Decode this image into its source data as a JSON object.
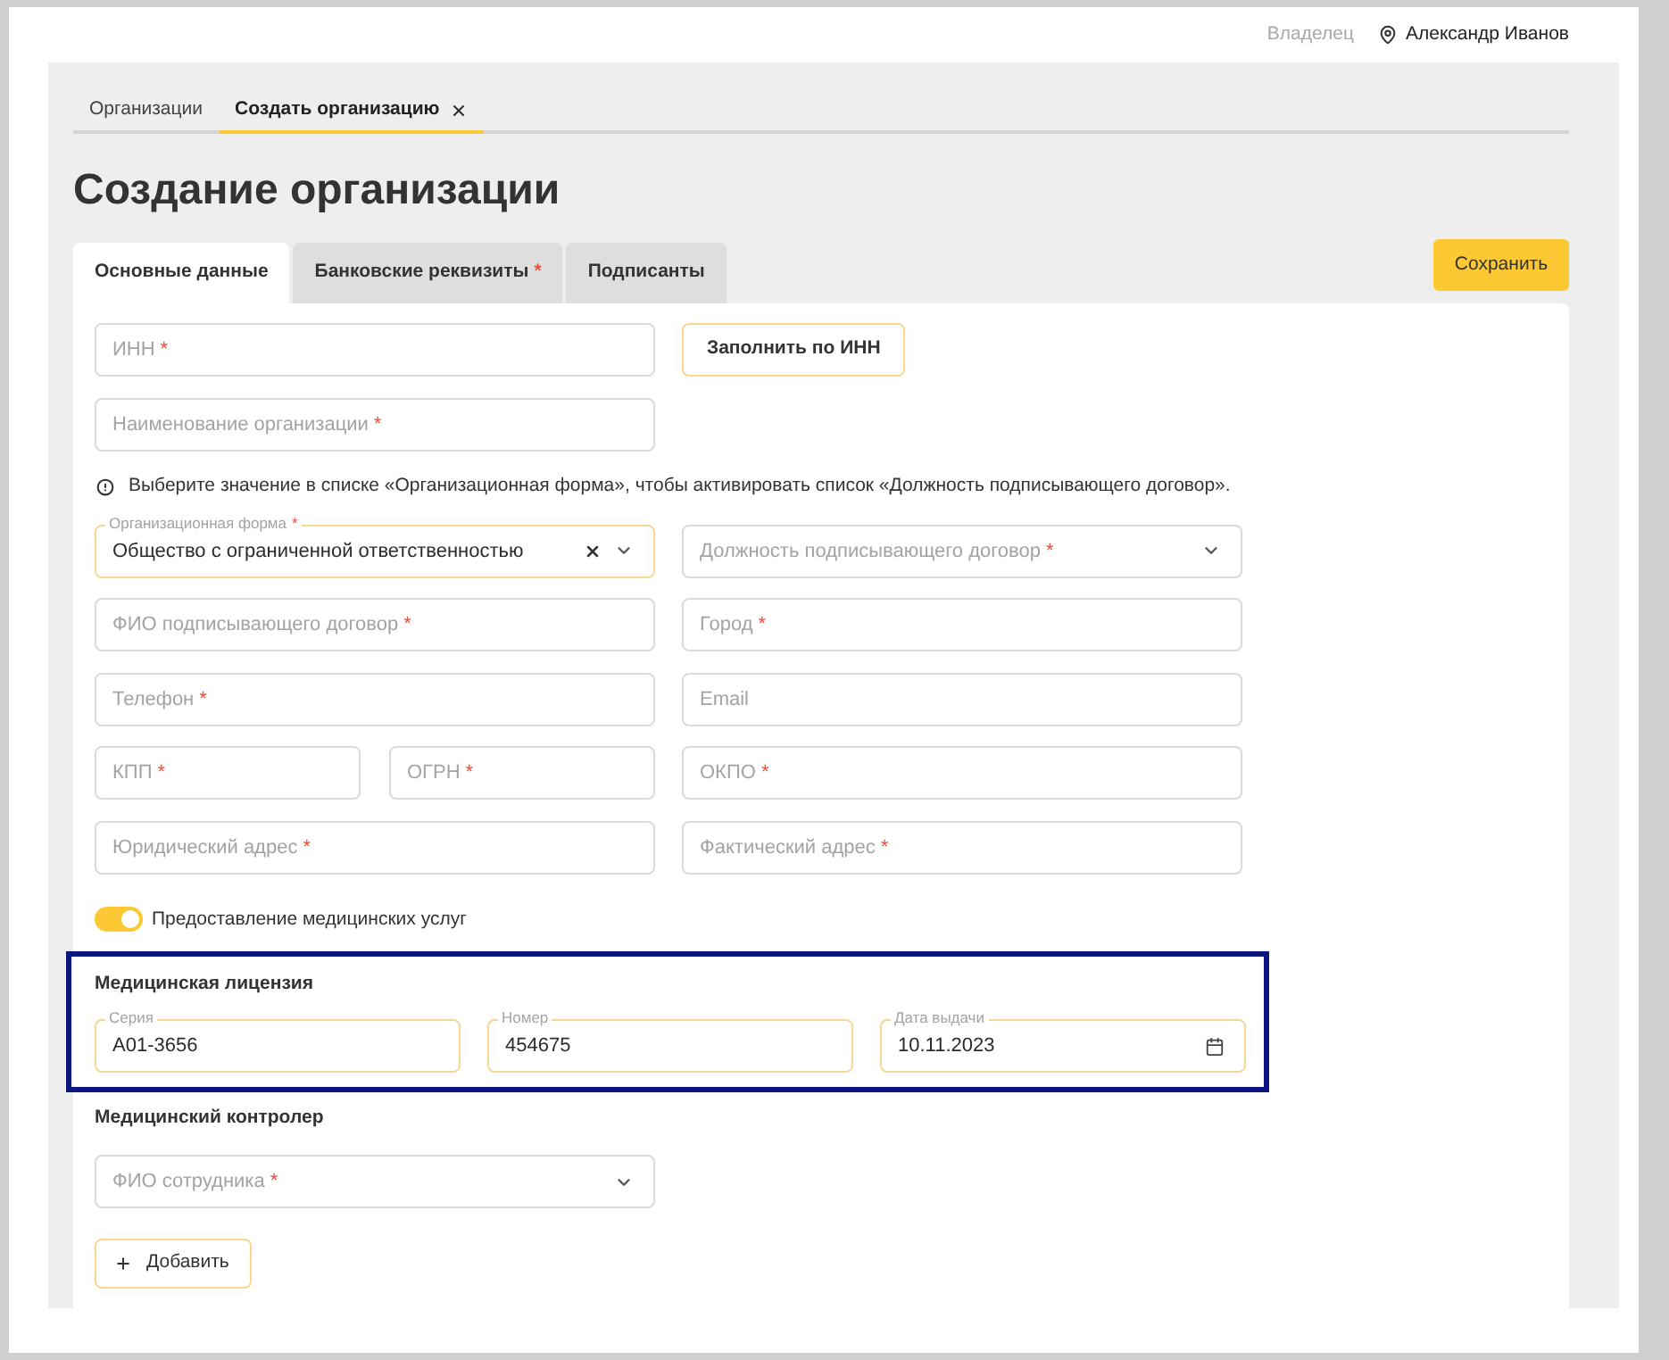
{
  "header": {
    "role": "Владелец",
    "user": "Александр Иванов"
  },
  "page_tabs": [
    {
      "label": "Организации",
      "selected": false,
      "closable": false
    },
    {
      "label": "Создать организацию",
      "selected": true,
      "closable": true
    }
  ],
  "title": "Создание организации",
  "form_tabs": [
    {
      "label": "Основные данные",
      "selected": true
    },
    {
      "label": "Банковские реквизиты",
      "required_mark": "*",
      "selected": false
    },
    {
      "label": "Подписанты",
      "selected": false
    }
  ],
  "save_button": "Сохранить",
  "form_rows": [
    {
      "kind": "fields",
      "left": [
        {
          "kind": "input",
          "placeholder": "ИНН",
          "required_mark": "*"
        }
      ],
      "right": [
        {
          "kind": "button",
          "label": "Заполнить по ИНН"
        }
      ]
    },
    {
      "kind": "fields",
      "left": [
        {
          "kind": "input",
          "placeholder": "Наименование организации",
          "required_mark": "*"
        }
      ]
    },
    {
      "kind": "notice",
      "text": "Выберите значение в списке «Организационная форма», чтобы активировать список «Должность подписывающего договор»."
    },
    {
      "kind": "fields",
      "left": [
        {
          "kind": "select",
          "label": "Организационная форма",
          "required_mark": "*",
          "value": "Общество с ограниченной ответственностью",
          "clearable": true
        }
      ],
      "right": [
        {
          "kind": "select",
          "placeholder": "Должность подписывающего договор",
          "required_mark": "*"
        }
      ]
    },
    {
      "kind": "fields",
      "left": [
        {
          "kind": "input",
          "placeholder": "ФИО подписывающего договор",
          "required_mark": "*"
        }
      ],
      "right": [
        {
          "kind": "input",
          "placeholder": "Город",
          "required_mark": "*"
        }
      ]
    },
    {
      "kind": "fields",
      "left": [
        {
          "kind": "input",
          "placeholder": "Телефон",
          "required_mark": "*"
        }
      ],
      "right": [
        {
          "kind": "input",
          "placeholder": "Email"
        }
      ]
    },
    {
      "kind": "fields",
      "left": [
        {
          "kind": "input",
          "placeholder": "КПП",
          "required_mark": "*"
        },
        {
          "kind": "input",
          "placeholder": "ОГРН",
          "required_mark": "*"
        }
      ],
      "right": [
        {
          "kind": "input",
          "placeholder": "ОКПО",
          "required_mark": "*"
        }
      ]
    },
    {
      "kind": "fields",
      "left": [
        {
          "kind": "input",
          "placeholder": "Юридический адрес",
          "required_mark": "*"
        }
      ],
      "right": [
        {
          "kind": "input",
          "placeholder": "Фактический адрес",
          "required_mark": "*"
        }
      ]
    }
  ],
  "medical_services": {
    "label": "Предоставление медицинских услуг",
    "on": true
  },
  "license": {
    "title": "Медицинская лицензия",
    "highlighted": true,
    "fields": [
      {
        "kind": "input",
        "label": "Серия",
        "value": "A01-3656"
      },
      {
        "kind": "input",
        "label": "Номер",
        "value": "454675"
      },
      {
        "kind": "date",
        "label": "Дата выдачи",
        "value": "10.11.2023"
      }
    ]
  },
  "controller": {
    "title": "Медицинский контролер",
    "fields": [
      {
        "kind": "select",
        "placeholder": "ФИО сотрудника",
        "required_mark": "*"
      }
    ],
    "add_button": "Добавить"
  }
}
